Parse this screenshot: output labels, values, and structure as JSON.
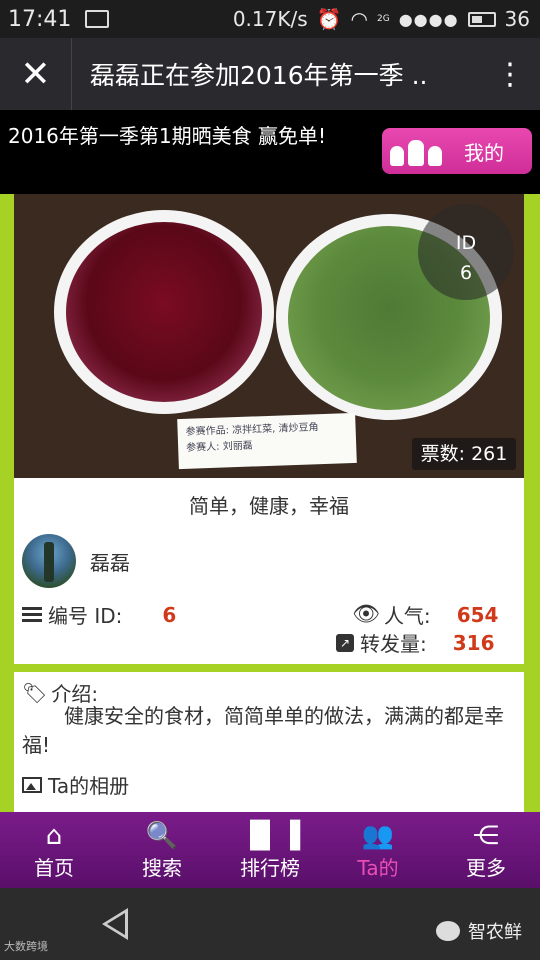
{
  "status_bar": {
    "time": "17:41",
    "speed": "0.17K/s",
    "network": "2G",
    "battery": "36"
  },
  "title_bar": {
    "title": "磊磊正在参加2016年第一季 .."
  },
  "header": {
    "activity_text": "2016年第一季第1期晒美食 赢免单!",
    "mine_button_label": "我的"
  },
  "entry": {
    "id_label": "ID",
    "id_value": "6",
    "votes_text": "票数: 261",
    "caption": "简单，健康，幸福",
    "username": "磊磊",
    "number_label": "编号 ID:",
    "number_value": "6",
    "popularity_label": "人气:",
    "popularity_value": "654",
    "shares_label": "转发量:",
    "shares_value": "316",
    "note_line1": "参赛作品: 凉拌红菜, 清炒豆角",
    "note_line2": "参赛人: 刘丽磊"
  },
  "intro": {
    "heading": "介绍:",
    "text": "健康安全的食材，简简单单的做法，满满的都是幸福!",
    "album_heading": "Ta的相册"
  },
  "nav": {
    "items": [
      {
        "label": "首页",
        "icon": "home-icon"
      },
      {
        "label": "搜索",
        "icon": "search-icon"
      },
      {
        "label": "排行榜",
        "icon": "bar-chart-icon"
      },
      {
        "label": "Ta的",
        "icon": "people-icon",
        "active": true
      },
      {
        "label": "更多",
        "icon": "share-icon"
      }
    ]
  },
  "watermark": {
    "left": "大数跨境",
    "right": "智农鲜"
  },
  "colors": {
    "accent": "#cf2e98",
    "nav_bg": "#6a1679",
    "content_bg": "#a5d224",
    "number": "#d03a1a"
  }
}
